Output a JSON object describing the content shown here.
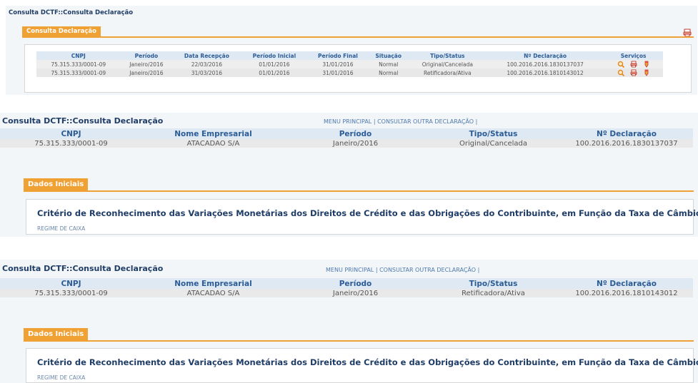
{
  "panel1": {
    "title": "Consulta DCTF::Consulta Declaração",
    "tab": "Consulta Declaração",
    "columns": [
      "CNPJ",
      "Período",
      "Data Recepção",
      "Período Inicial",
      "Período Final",
      "Situação",
      "Tipo/Status",
      "Nº Declaração",
      "Serviços"
    ],
    "rows": [
      [
        "75.315.333/0001-09",
        "Janeiro/2016",
        "22/03/2016",
        "01/01/2016",
        "31/01/2016",
        "Normal",
        "Original/Cancelada",
        "100.2016.2016.1830137037"
      ],
      [
        "75.315.333/0001-09",
        "Janeiro/2016",
        "31/03/2016",
        "01/01/2016",
        "31/01/2016",
        "Normal",
        "Retificadora/Ativa",
        "100.2016.2016.1810143012"
      ]
    ],
    "service_icons": [
      "magnifier-icon",
      "printer-icon",
      "pencil-icon"
    ]
  },
  "panel2": {
    "title": "Consulta DCTF::Consulta Declaração",
    "nav_menu": "MENU PRINCIPAL",
    "nav_sep": "|",
    "nav_other": "CONSULTAR OUTRA DECLARAÇÃO",
    "columns": [
      "CNPJ",
      "Nome Empresarial",
      "Período",
      "Tipo/Status",
      "Nº Declaração"
    ],
    "row": [
      "75.315.333/0001-09",
      "ATACADAO S/A",
      "Janeiro/2016",
      "Original/Cancelada",
      "100.2016.2016.1830137037"
    ],
    "tab": "Dados Iniciais",
    "heading": "Critério de Reconhecimento das Variações Monetárias dos Direitos de Crédito e das Obrigações do Contribuinte, em Função da Taxa de Câmbio",
    "value": "REGIME DE CAIXA"
  },
  "panel3": {
    "title": "Consulta DCTF::Consulta Declaração",
    "nav_menu": "MENU PRINCIPAL",
    "nav_sep": "|",
    "nav_other": "CONSULTAR OUTRA DECLARAÇÃO",
    "columns": [
      "CNPJ",
      "Nome Empresarial",
      "Período",
      "Tipo/Status",
      "Nº Declaração"
    ],
    "row": [
      "75.315.333/0001-09",
      "ATACADAO S/A",
      "Janeiro/2016",
      "Retificadora/Ativa",
      "100.2016.2016.1810143012"
    ],
    "tab": "Dados Iniciais",
    "heading": "Critério de Reconhecimento das Variações Monetárias dos Direitos de Crédito e das Obrigações do Contribuinte, em Função da Taxa de Câmbio",
    "value": "REGIME DE CAIXA"
  },
  "colors": {
    "accent": "#f0a134",
    "header_bg": "#dfe9f3",
    "title": "#1f3d66"
  }
}
